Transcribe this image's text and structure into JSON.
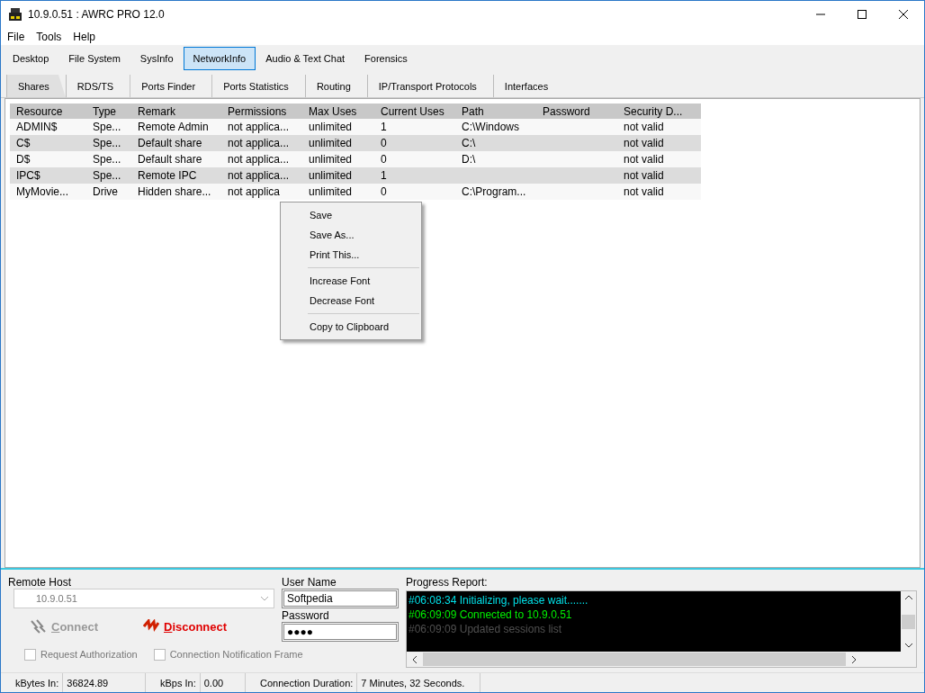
{
  "window": {
    "title": "10.9.0.51 : AWRC PRO 12.0"
  },
  "menu": [
    "File",
    "Tools",
    "Help"
  ],
  "tabs": [
    {
      "label": "Desktop",
      "selected": false
    },
    {
      "label": "File System",
      "selected": false
    },
    {
      "label": "SysInfo",
      "selected": false
    },
    {
      "label": "NetworkInfo",
      "selected": true
    },
    {
      "label": "Audio & Text Chat",
      "selected": false
    },
    {
      "label": "Forensics",
      "selected": false
    }
  ],
  "subtabs": [
    {
      "label": "Shares",
      "selected": true
    },
    {
      "label": "RDS/TS",
      "selected": false
    },
    {
      "label": "Ports Finder",
      "selected": false
    },
    {
      "label": "Ports Statistics",
      "selected": false
    },
    {
      "label": "Routing",
      "selected": false
    },
    {
      "label": "IP/Transport Protocols",
      "selected": false
    },
    {
      "label": "Interfaces",
      "selected": false
    }
  ],
  "table": {
    "columns": [
      "Resource",
      "Type",
      "Remark",
      "Permissions",
      "Max Uses",
      "Current Uses",
      "Path",
      "Password",
      "Security D..."
    ],
    "rows": [
      [
        "ADMIN$",
        "Spe...",
        "Remote Admin",
        "not applica...",
        "unlimited",
        "1",
        "C:\\Windows",
        "",
        "not valid"
      ],
      [
        "C$",
        "Spe...",
        "Default share",
        "not applica...",
        "unlimited",
        "0",
        "C:\\",
        "",
        "not valid"
      ],
      [
        "D$",
        "Spe...",
        "Default share",
        "not applica...",
        "unlimited",
        "0",
        "D:\\",
        "",
        "not valid"
      ],
      [
        "IPC$",
        "Spe...",
        "Remote IPC",
        "not applica...",
        "unlimited",
        "1",
        "",
        "",
        "not valid"
      ],
      [
        "MyMovie...",
        "Drive",
        "Hidden share...",
        "not applica",
        "unlimited",
        "0",
        "C:\\Program...",
        "",
        "not valid"
      ]
    ]
  },
  "context_menu": [
    [
      "Save",
      "Save As...",
      "Print This..."
    ],
    [
      "Increase Font",
      "Decrease Font"
    ],
    [
      "Copy to Clipboard"
    ]
  ],
  "connection": {
    "remote_host_label": "Remote Host",
    "remote_host": "10.9.0.51",
    "connect": {
      "label": "Connect",
      "disabled": true
    },
    "disconnect": {
      "label": "Disconnect",
      "disabled": false
    },
    "user_name_label": "User Name",
    "user_name": "Softpedia",
    "password_label": "Password",
    "password": "●●●●",
    "checkboxes": [
      {
        "label": "Request Authorization",
        "checked": false
      },
      {
        "label": "Connection Notification Frame",
        "checked": false
      }
    ]
  },
  "progress": {
    "label": "Progress Report:",
    "lines": [
      {
        "text": "#06:08:34 Initializing, please wait.......",
        "color": "#00e0e8"
      },
      {
        "text": "#06:09:09 Connected to 10.9.0.51",
        "color": "#00f000"
      },
      {
        "text": "#06:09:09 Updated sessions list",
        "color": "#505050"
      }
    ]
  },
  "status_bar": [
    {
      "label": "kBytes In:",
      "value": "36824.89"
    },
    {
      "label": "kBps In:",
      "value": "0.00"
    },
    {
      "label": "Connection Duration:",
      "value": "7 Minutes, 32 Seconds."
    }
  ]
}
